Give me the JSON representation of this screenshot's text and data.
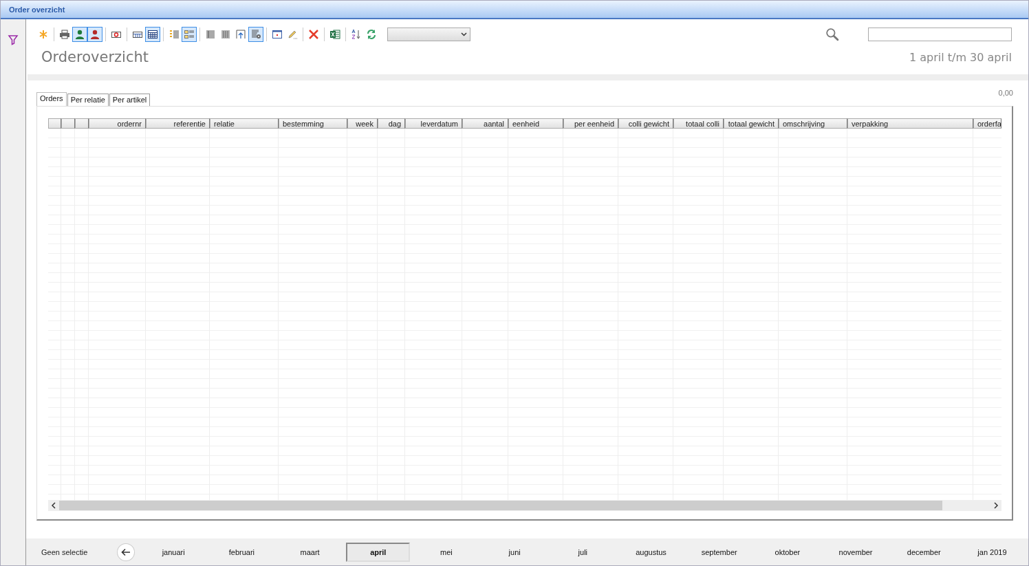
{
  "window": {
    "title": "Order overzicht"
  },
  "toolbar": {
    "groups": [
      [
        {
          "kind": "star",
          "pressed": false
        }
      ],
      [
        {
          "kind": "printer",
          "pressed": false
        },
        {
          "kind": "person-green",
          "pressed": true
        },
        {
          "kind": "person-red",
          "pressed": true
        }
      ],
      [
        {
          "kind": "record",
          "pressed": false
        }
      ],
      [
        {
          "kind": "grid-small",
          "pressed": false
        },
        {
          "kind": "grid-large",
          "pressed": true
        }
      ],
      [
        {
          "kind": "list",
          "pressed": false
        },
        {
          "kind": "list-boxes",
          "pressed": true
        }
      ],
      [
        {
          "kind": "table",
          "pressed": false
        },
        {
          "kind": "table-dense",
          "pressed": false
        },
        {
          "kind": "align-top",
          "pressed": false
        },
        {
          "kind": "table-gear",
          "pressed": true
        }
      ],
      [
        {
          "kind": "calendar",
          "pressed": false
        },
        {
          "kind": "pencil",
          "pressed": false
        }
      ],
      [
        {
          "kind": "delete",
          "pressed": false
        }
      ],
      [
        {
          "kind": "excel",
          "pressed": false
        }
      ],
      [
        {
          "kind": "sort",
          "pressed": false
        },
        {
          "kind": "refresh",
          "pressed": false
        }
      ]
    ]
  },
  "title": "Orderoverzicht",
  "period": "1 april t/m 30 april",
  "total": "0,00",
  "tabs": [
    {
      "label": "Orders",
      "selected": true
    },
    {
      "label": "Per relatie",
      "selected": false
    },
    {
      "label": "Per artikel",
      "selected": false
    }
  ],
  "table": {
    "columns": [
      {},
      {},
      {},
      {
        "label": "ordernr"
      },
      {
        "label": "referentie"
      },
      {
        "label": "relatie"
      },
      {
        "label": "bestemming"
      },
      {
        "label": "week"
      },
      {
        "label": "dag"
      },
      {
        "label": "leverdatum"
      },
      {
        "label": "aantal"
      },
      {
        "label": "eenheid"
      },
      {
        "label": "per eenheid"
      },
      {
        "label": "colli gewicht"
      },
      {
        "label": "totaal colli"
      },
      {
        "label": "totaal gewicht"
      },
      {
        "label": "omschrijving"
      },
      {
        "label": "verpakking"
      },
      {
        "label": "orderfa"
      }
    ]
  },
  "footer": {
    "no_selection": "Geen selectie",
    "months": [
      {
        "label": "januari",
        "selected": false
      },
      {
        "label": "februari",
        "selected": false
      },
      {
        "label": "maart",
        "selected": false
      },
      {
        "label": "april",
        "selected": true
      },
      {
        "label": "mei",
        "selected": false
      },
      {
        "label": "juni",
        "selected": false
      },
      {
        "label": "juli",
        "selected": false
      },
      {
        "label": "augustus",
        "selected": false
      },
      {
        "label": "september",
        "selected": false
      },
      {
        "label": "oktober",
        "selected": false
      },
      {
        "label": "november",
        "selected": false
      },
      {
        "label": "december",
        "selected": false
      },
      {
        "label": "jan 2019",
        "selected": false
      }
    ]
  }
}
